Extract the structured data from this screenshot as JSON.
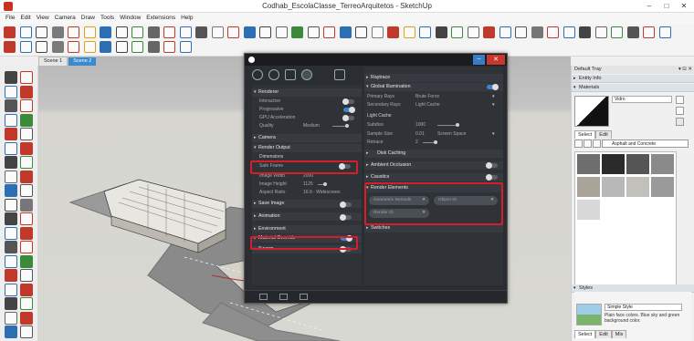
{
  "window": {
    "title": "Codhab_EscolaClasse_TerreoArquitetos - SketchUp",
    "minimize": "–",
    "maximize": "□",
    "close": "✕"
  },
  "menu": [
    "File",
    "Edit",
    "View",
    "Camera",
    "Draw",
    "Tools",
    "Window",
    "Extensions",
    "Help"
  ],
  "scenes": [
    "Scene 1",
    "Scene 2"
  ],
  "vray": {
    "min": "–",
    "close": "✕",
    "left": {
      "renderer": "Renderer",
      "interactive": "Interactive",
      "progressive": "Progressive",
      "gpu": "GPU Acceleration",
      "quality": "Quality",
      "quality_value": "Medium",
      "camera": "Camera",
      "render_output": "Render Output",
      "dimensions": "Dimensions",
      "safe_frame": "Safe Frame",
      "image_width": "Image Width",
      "image_width_value": "2000",
      "image_height": "Image Height",
      "image_height_value": "1125",
      "aspect_ratio": "Aspect Ratio",
      "aspect_ratio_value": "16:9 - Widescreen",
      "save_image": "Save Image",
      "animation": "Animation",
      "environment": "Environment",
      "material_override": "Material Override",
      "swarm": "Swarm"
    },
    "right": {
      "raytrace": "Raytrace",
      "gi": "Global Illumination",
      "primary_rays": "Primary Rays",
      "primary_rays_value": "Brute Force",
      "secondary_rays": "Secondary Rays",
      "secondary_rays_value": "Light Cache",
      "light_cache": "Light Cache",
      "subdivs": "Subdivs",
      "subdivs_value": "1000",
      "sample_size": "Sample Size",
      "sample_size_value": "0.01",
      "sample_size_unit": "Screen Space",
      "retrace": "Retrace",
      "retrace_value": "2",
      "disk_caching": "Disk Caching",
      "ambient_occlusion": "Ambient Occlusion",
      "caustics": "Caustics",
      "render_elements": "Render Elements",
      "elem1": "Geometric Normals",
      "elem2": "Object ID",
      "elem3": "Render ID",
      "switches": "Switches"
    }
  },
  "tray": {
    "title": "Default Tray",
    "entity_info": "Entity Info",
    "materials": "Materials",
    "material_name": "Vidro",
    "tab_select": "Select",
    "tab_edit": "Edit",
    "tab_mix": "Mix",
    "library": "Asphalt and Concrete",
    "styles": "Styles",
    "style_name": "Simple Style",
    "style_desc": "Plain face colors. Blue sky and green background color."
  },
  "colors": {
    "accent": "#3b86c8",
    "highlight": "#d51e2a",
    "vray_bg": "#2a2e33"
  }
}
